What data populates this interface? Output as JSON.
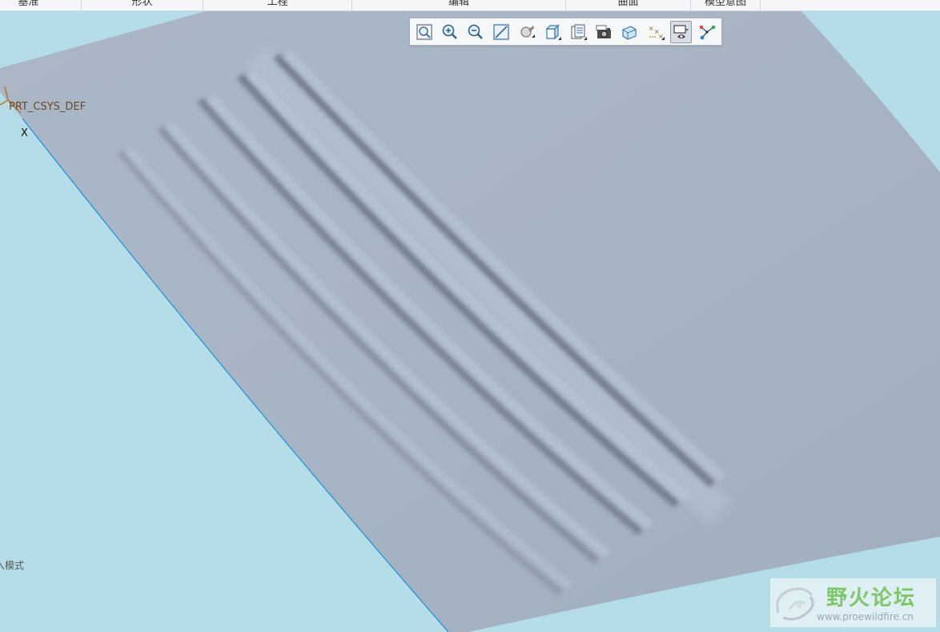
{
  "ribbon": {
    "groups": [
      {
        "label": "基准"
      },
      {
        "label": "形状"
      },
      {
        "label": "工程"
      },
      {
        "label": "编辑"
      },
      {
        "label": "曲面"
      },
      {
        "label": "模型意图"
      }
    ]
  },
  "graphics_toolbar": {
    "buttons": [
      {
        "icon": "refit-icon",
        "active": false
      },
      {
        "icon": "zoom-in-icon",
        "active": false
      },
      {
        "icon": "zoom-out-icon",
        "active": false
      },
      {
        "icon": "repaint-icon",
        "active": false
      },
      {
        "icon": "perspective-icon",
        "active": false
      },
      {
        "icon": "display-style-icon",
        "active": false
      },
      {
        "icon": "saved-orientations-icon",
        "active": false
      },
      {
        "icon": "view-manager-icon",
        "active": false
      },
      {
        "icon": "section-icon",
        "active": false
      },
      {
        "icon": "datum-display-icon",
        "active": false
      },
      {
        "icon": "annotation-display-icon",
        "active": true
      },
      {
        "icon": "spin-center-icon",
        "active": false
      }
    ]
  },
  "viewport": {
    "csys_label": "PRT_CSYS_DEF",
    "axis_label": "X",
    "mode_text": "入模式",
    "background_color": "#b5dde7",
    "surface_color": "#a6b4c4"
  },
  "watermark": {
    "title": "野火论坛",
    "url": "www.proewildfire.cn"
  }
}
